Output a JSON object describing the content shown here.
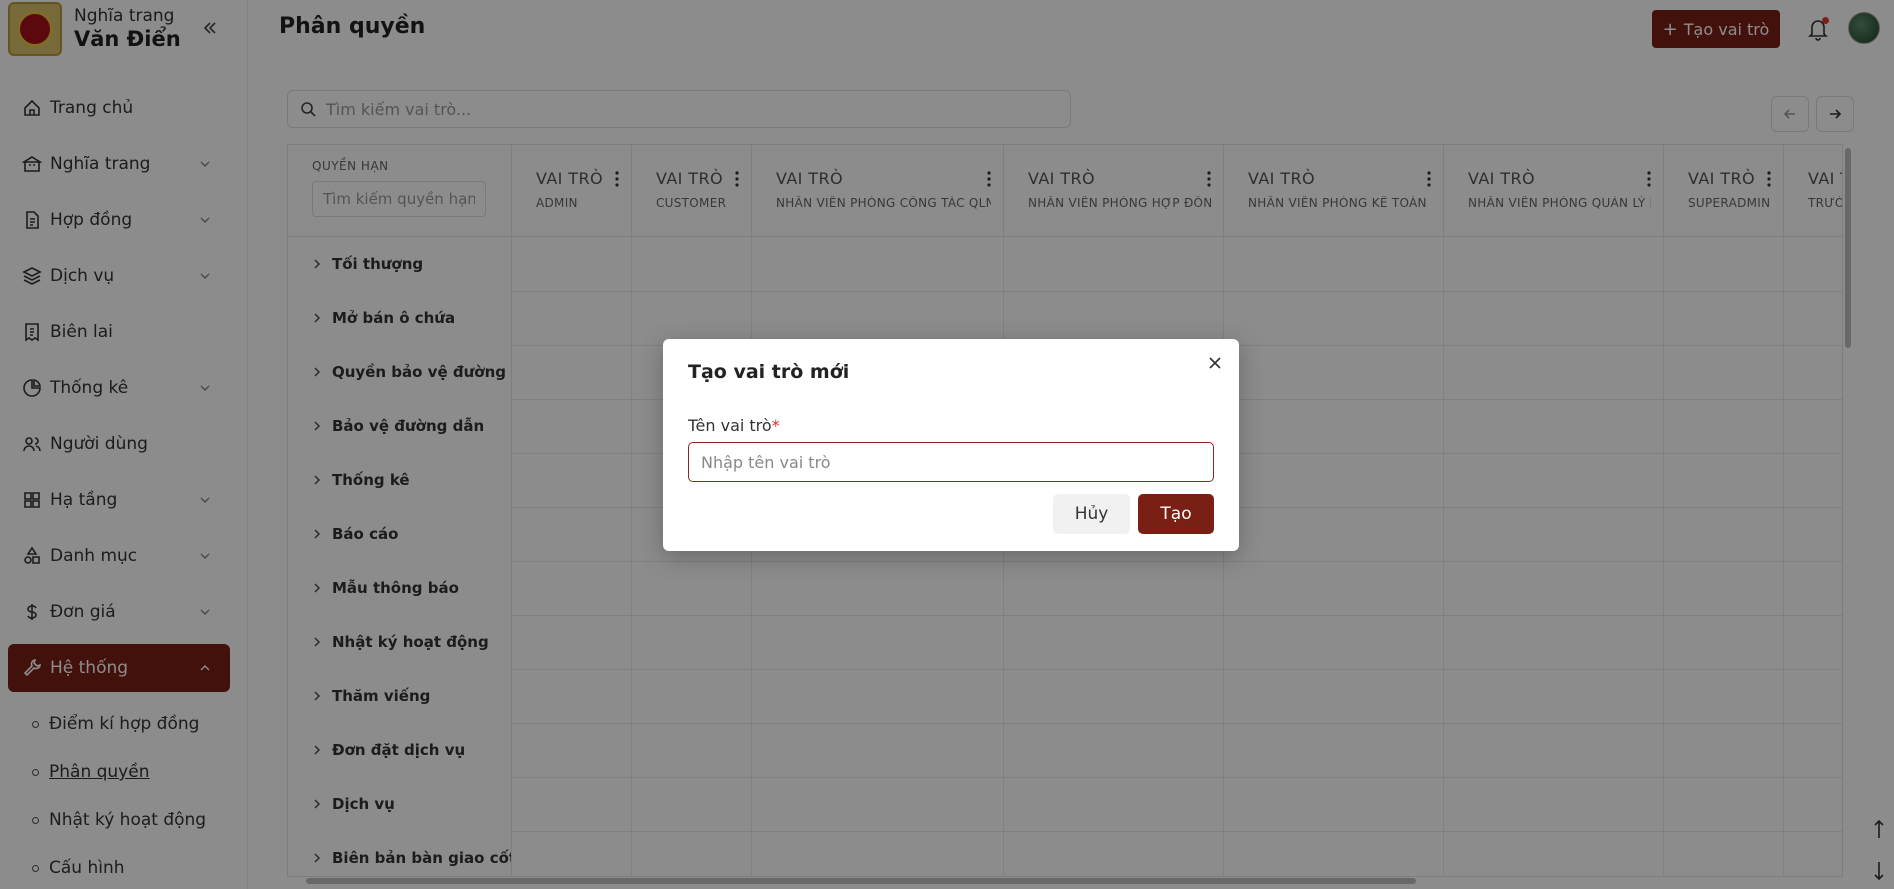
{
  "app": {
    "brand_line1": "Nghĩa trang",
    "brand_line2": "Văn Điển"
  },
  "sidebar": {
    "items": [
      {
        "label": "Trang chủ",
        "icon": "home-icon",
        "expandable": false
      },
      {
        "label": "Nghĩa trang",
        "icon": "building-icon",
        "expandable": true
      },
      {
        "label": "Hợp đồng",
        "icon": "document-icon",
        "expandable": true
      },
      {
        "label": "Dịch vụ",
        "icon": "layers-icon",
        "expandable": true
      },
      {
        "label": "Biên lai",
        "icon": "receipt-icon",
        "expandable": false
      },
      {
        "label": "Thống kê",
        "icon": "pie-chart-icon",
        "expandable": true
      },
      {
        "label": "Người dùng",
        "icon": "users-icon",
        "expandable": false
      },
      {
        "label": "Hạ tầng",
        "icon": "grid-icon",
        "expandable": true
      },
      {
        "label": "Danh mục",
        "icon": "shapes-icon",
        "expandable": true
      },
      {
        "label": "Đơn giá",
        "icon": "dollar-icon",
        "expandable": true
      },
      {
        "label": "Hệ thống",
        "icon": "wrench-icon",
        "expandable": true,
        "active": true
      }
    ],
    "sub_items": [
      {
        "label": "Điểm kí hợp đồng"
      },
      {
        "label": "Phân quyền",
        "current": true
      },
      {
        "label": "Nhật ký hoạt động"
      },
      {
        "label": "Cấu hình"
      }
    ]
  },
  "header": {
    "title": "Phân quyền",
    "create_button": "Tạo vai trò"
  },
  "search": {
    "placeholder": "Tìm kiếm vai trò..."
  },
  "table": {
    "permission_header": "QUYỀN HẠN",
    "permission_search_placeholder": "Tìm kiếm quyền hạn",
    "role_prefix": "VAI TRÒ",
    "roles": [
      {
        "name": "ADMIN"
      },
      {
        "name": "CUSTOMER"
      },
      {
        "name": "NHÂN VIÊN PHÒNG CÔNG TÁC QLNT"
      },
      {
        "name": "NHÂN VIÊN PHÒNG HỢP ĐỒNG"
      },
      {
        "name": "NHÂN VIÊN PHÒNG KẾ TOÁN"
      },
      {
        "name": "NHÂN VIÊN PHÒNG QUẢN LÝ NT"
      },
      {
        "name": "SUPERADMIN"
      },
      {
        "name": "TRƯỜNG"
      }
    ],
    "permissions": [
      "Tối thượng",
      "Mở bán ô chứa",
      "Quyền bảo vệ đường dẫn",
      "Bảo vệ đường dẫn",
      "Thống kê",
      "Báo cáo",
      "Mẫu thông báo",
      "Nhật ký hoạt động",
      "Thăm viếng",
      "Đơn đặt dịch vụ",
      "Dịch vụ",
      "Biên bản bàn giao cốt"
    ]
  },
  "modal": {
    "title": "Tạo vai trò mới",
    "field_label": "Tên vai trò",
    "required_mark": "*",
    "input_placeholder": "Nhập tên vai trò",
    "input_value": "",
    "cancel_label": "Hủy",
    "submit_label": "Tạo"
  },
  "colors": {
    "accent": "#7a1f14",
    "overlay": "rgba(0,0,0,0.45)",
    "badge": "#e53935"
  }
}
